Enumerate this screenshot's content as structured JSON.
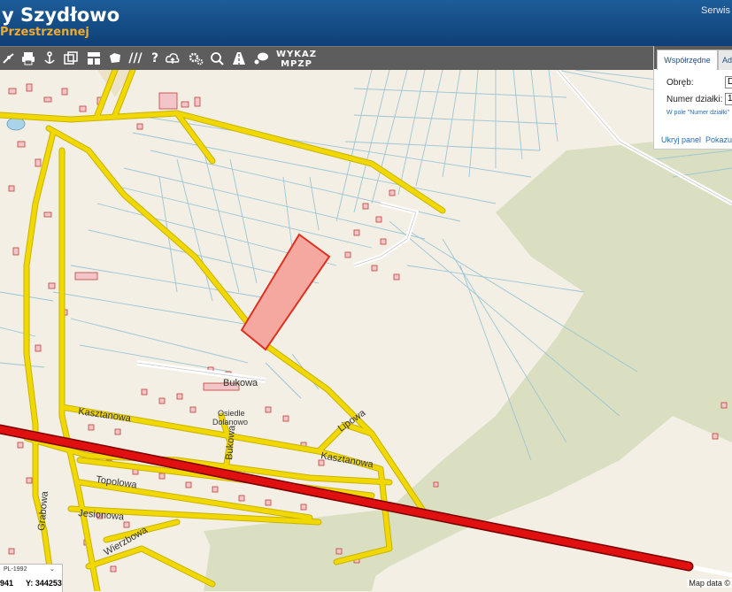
{
  "header": {
    "title": "y Szydłowo",
    "subtitle": "Przestrzennej",
    "link": "Serwis"
  },
  "toolbar": {
    "wykaz_line1": "WYKAZ",
    "wykaz_line2": "MPZP",
    "help_glyph": "?",
    "hatch_glyph": "///"
  },
  "panel": {
    "tab_active": "Współrzędne",
    "tab_second": "Ad",
    "obreb_label": "Obręb:",
    "obreb_value": "D",
    "numer_label": "Numer działki:",
    "numer_value": "1",
    "hint": "W pole \"Numer działki\"",
    "hide_link": "Ukryj panel",
    "show_link": "Pokazuj"
  },
  "coords": {
    "crs": "PL-1992",
    "x": "941",
    "y_label": "Y:",
    "y": "344253"
  },
  "map": {
    "attribution": "Map data ©",
    "streets": {
      "bukowa": "Bukowa",
      "kasztanowa_w": "Kasztanowa",
      "kasztanowa_e": "Kasztanowa",
      "lipowa": "Lipowa",
      "topolowa": "Topolowa",
      "jesionowa": "Jesionowa",
      "wierzbowa": "Wierzbowa",
      "grabowa": "Grabowa",
      "bukowa_v": "Bukowa",
      "osiedle1": "Osiedle",
      "osiedle2": "Dolanowo"
    }
  },
  "colors": {
    "header_bg": "#1a5590",
    "subtitle": "#f3a92b",
    "toolbar_bg": "#5d5d5d",
    "road": "#f0d800",
    "railway": "#e01010",
    "parcel_fill": "#f4a8a0",
    "parcel_stroke": "#e03020",
    "field_green": "#d9dfc0"
  }
}
